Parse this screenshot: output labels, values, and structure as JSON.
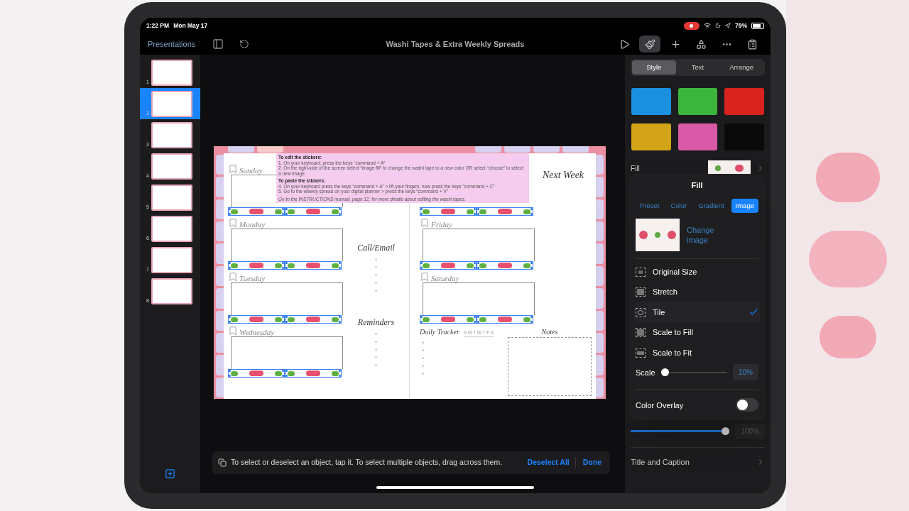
{
  "status_bar": {
    "time": "1:22 PM",
    "date": "Mon May 17",
    "battery": "79%"
  },
  "toolbar": {
    "back": "Presentations",
    "title": "Washi Tapes & Extra Weekly Spreads",
    "tools": [
      {
        "kind": "play",
        "selected": false
      },
      {
        "kind": "brush",
        "selected": true
      },
      {
        "kind": "add",
        "selected": false
      },
      {
        "kind": "shapes",
        "selected": false
      },
      {
        "kind": "more",
        "selected": false
      },
      {
        "kind": "document",
        "selected": false
      }
    ]
  },
  "slides": [
    {
      "number": "1",
      "selected": false
    },
    {
      "number": "2",
      "selected": true
    },
    {
      "number": "3",
      "selected": false
    },
    {
      "number": "4",
      "selected": false
    },
    {
      "number": "5",
      "selected": false
    },
    {
      "number": "6",
      "selected": false
    },
    {
      "number": "7",
      "selected": false
    },
    {
      "number": "8",
      "selected": false
    }
  ],
  "slide": {
    "top_tabs": [
      {
        "selected": false
      },
      {
        "selected": true
      },
      {
        "selected": false
      },
      {
        "selected": false
      },
      {
        "selected": false
      },
      {
        "selected": false
      }
    ],
    "instructions": {
      "heading_1": "To edit the stickers:",
      "lines_1": [
        "1. On your keyboard, press the keys “command + A”",
        "2. On the right-side of the screen select “image fill” to change the washi tape to a new color OR select “choose” to select a new image."
      ],
      "heading_2": "To paste the stickers:",
      "lines_2": [
        "4. On your keyboard press the keys “command + A” > lift your fingers, now press the keys “command + C”",
        "5. Go to the weekly spread on your digital planner > press the keys “command + V”"
      ],
      "footer": "Go to the INSTRUCTIONS manual, page 12, for more details about editing the washi tapes."
    },
    "left_days": [
      {
        "kind": "day",
        "label": "Sunday"
      },
      {
        "kind": "day",
        "label": "Monday"
      },
      {
        "kind": "day",
        "label": "Tuesday"
      },
      {
        "kind": "day",
        "label": "Wednesday"
      }
    ],
    "side_labels": [
      "Call/Email",
      "Reminders"
    ],
    "right_days": [
      {
        "kind": "covered"
      },
      {
        "kind": "day",
        "label": "Friday"
      },
      {
        "kind": "day",
        "label": "Saturday"
      }
    ],
    "next_week": "Next Week",
    "tracker": {
      "title": "Daily Tracker",
      "weekdays": "S M T W T F S"
    },
    "notes": "Notes"
  },
  "hint_bar": {
    "text": "To select or deselect an object, tap it. To select multiple objects, drag across them.",
    "deselect": "Deselect All",
    "done": "Done"
  },
  "inspector": {
    "tabs": [
      {
        "label": "Style",
        "selected": true
      },
      {
        "label": "Text",
        "selected": false
      },
      {
        "label": "Arrange",
        "selected": false
      }
    ],
    "swatches": [
      {
        "color": "#1b8fe0"
      },
      {
        "color": "#3cb53c"
      },
      {
        "color": "#d8231e"
      },
      {
        "color": "#d3a417"
      },
      {
        "color": "#d95aa6"
      },
      {
        "color": "#0a0a0a"
      }
    ],
    "fill_label": "Fill",
    "opacity": {
      "level": 1,
      "reading": "100%"
    },
    "title_and_caption": "Title and Caption"
  },
  "fill_popover": {
    "title": "Fill",
    "tabs": [
      {
        "label": "Preset",
        "selected": false
      },
      {
        "label": "Color",
        "selected": false
      },
      {
        "label": "Gradient",
        "selected": false
      },
      {
        "label": "Image",
        "selected": true
      }
    ],
    "change_image": "Change image",
    "options": [
      {
        "kind": "original",
        "label": "Original Size",
        "selected": false
      },
      {
        "kind": "stretch",
        "label": "Stretch",
        "selected": false
      },
      {
        "kind": "tile",
        "label": "Tile",
        "selected": true
      },
      {
        "kind": "fill",
        "label": "Scale to Fill",
        "selected": false
      },
      {
        "kind": "fit",
        "label": "Scale to Fit",
        "selected": false
      }
    ],
    "scale": {
      "label": "Scale",
      "level": 0,
      "reading": "10%"
    },
    "color_overlay": {
      "label": "Color Overlay",
      "on": false
    }
  }
}
